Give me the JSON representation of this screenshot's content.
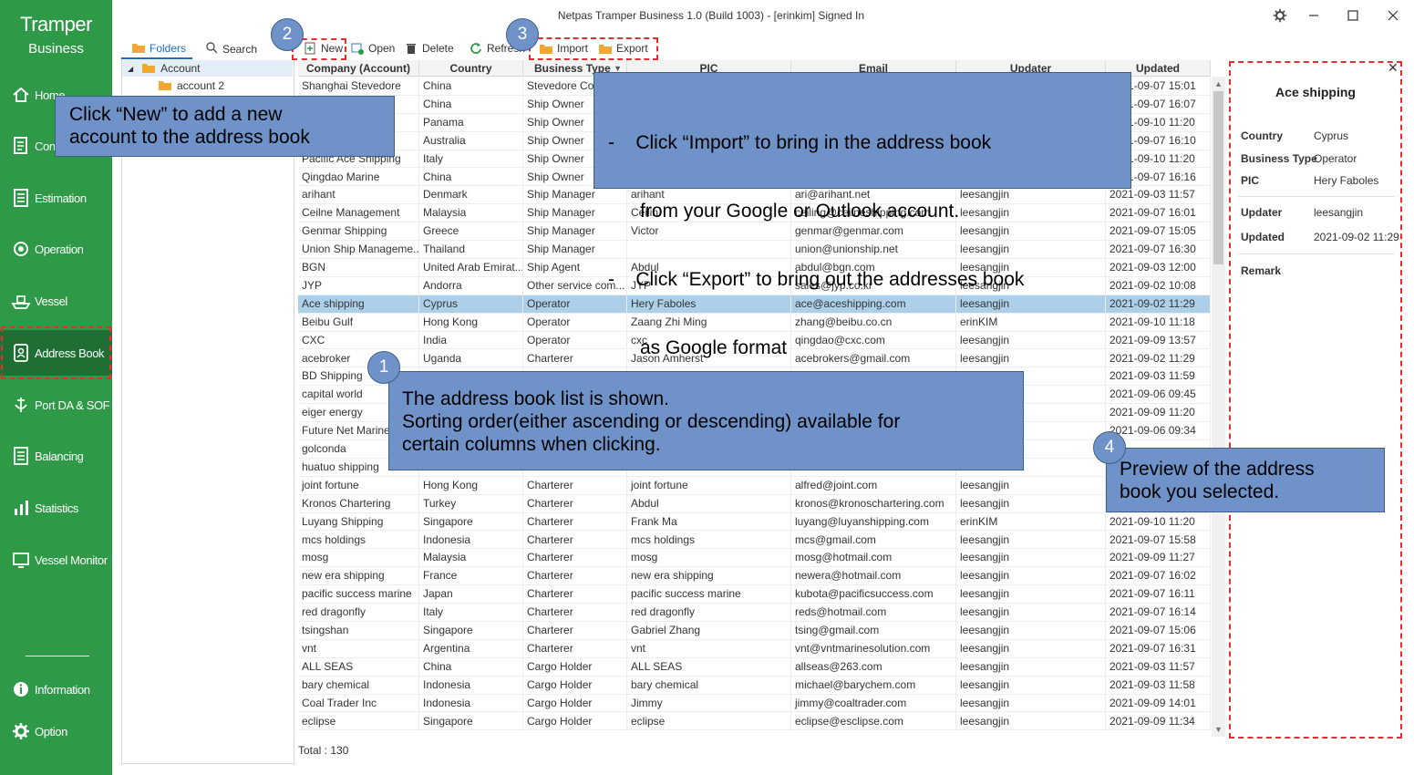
{
  "window": {
    "title": "Netpas Tramper Business 1.0 (Build 1003) - [erinkim] Signed In"
  },
  "brand": {
    "line1": "Tramper",
    "line2": "Business"
  },
  "sidebar": {
    "items": [
      {
        "label": "Home",
        "icon": "home-icon"
      },
      {
        "label": "Contract",
        "icon": "contract-icon"
      },
      {
        "label": "Estimation",
        "icon": "estimation-icon"
      },
      {
        "label": "Operation",
        "icon": "operation-icon"
      },
      {
        "label": "Vessel",
        "icon": "vessel-icon"
      },
      {
        "label": "Address Book",
        "icon": "address-book-icon"
      },
      {
        "label": "Port DA & SOF",
        "icon": "port-icon"
      },
      {
        "label": "Balancing",
        "icon": "balancing-icon"
      },
      {
        "label": "Statistics",
        "icon": "statistics-icon"
      },
      {
        "label": "Vessel Monitor",
        "icon": "vessel-monitor-icon"
      }
    ],
    "bottom": [
      {
        "label": "Information",
        "icon": "info-icon"
      },
      {
        "label": "Option",
        "icon": "gear-icon"
      }
    ]
  },
  "panel": {
    "tabs": {
      "folders": "Folders",
      "search": "Search"
    },
    "tree": {
      "root": "Account",
      "child": "account 2"
    }
  },
  "toolbar": {
    "new": "New",
    "open": "Open",
    "delete": "Delete",
    "refresh": "Refresh",
    "import": "Import",
    "export": "Export"
  },
  "table": {
    "columns": [
      "Company (Account)",
      "Country",
      "Business Type",
      "PIC",
      "Email",
      "Updater",
      "Updated"
    ],
    "rows": [
      [
        "Shanghai Stevedore",
        "China",
        "Stevedore Com...",
        "",
        "",
        "",
        "2021-09-07 15:01"
      ],
      [
        "",
        "China",
        "Ship Owner",
        "",
        "",
        "",
        "2021-09-07 16:07"
      ],
      [
        "",
        "Panama",
        "Ship Owner",
        "",
        "",
        "",
        "2021-09-10 11:20"
      ],
      [
        "",
        "Australia",
        "Ship Owner",
        "",
        "",
        "",
        "2021-09-07 16:10"
      ],
      [
        "Pacific Ace Shipping",
        "Italy",
        "Ship Owner",
        "",
        "",
        "",
        "2021-09-10 11:20"
      ],
      [
        "Qingdao Marine",
        "China",
        "Ship Owner",
        "",
        "",
        "",
        "2021-09-07 16:16"
      ],
      [
        "arihant",
        "Denmark",
        "Ship Manager",
        "arihant",
        "ari@arihant.net",
        "leesangjin",
        "2021-09-03 11:57"
      ],
      [
        "Ceilne Management",
        "Malaysia",
        "Ship Manager",
        "Ceilin",
        "ceiling@ceilneshipping.com",
        "leesangjin",
        "2021-09-07 16:01"
      ],
      [
        "Genmar Shipping",
        "Greece",
        "Ship Manager",
        "Victor",
        "genmar@genmar.com",
        "leesangjin",
        "2021-09-07 15:05"
      ],
      [
        "Union Ship Manageme...",
        "Thailand",
        "Ship Manager",
        "",
        "union@unionship.net",
        "leesangjin",
        "2021-09-07 16:30"
      ],
      [
        "BGN",
        "United Arab Emirat...",
        "Ship Agent",
        "Abdul",
        "abdul@bgn.com",
        "leesangjin",
        "2021-09-03 12:00"
      ],
      [
        "JYP",
        "Andorra",
        "Other service com...",
        "JYP",
        "sales@jyp.co.kr",
        "leesangjin",
        "2021-09-02 10:08"
      ],
      [
        "Ace shipping",
        "Cyprus",
        "Operator",
        "Hery Faboles",
        "ace@aceshipping.com",
        "leesangjin",
        "2021-09-02 11:29"
      ],
      [
        "Beibu Gulf",
        "Hong Kong",
        "Operator",
        "Zaang Zhi Ming",
        "zhang@beibu.co.cn",
        "erinKIM",
        "2021-09-10 11:18"
      ],
      [
        "CXC",
        "India",
        "Operator",
        "cxc",
        "qingdao@cxc.com",
        "leesangjin",
        "2021-09-09 13:57"
      ],
      [
        "acebroker",
        "Uganda",
        "Charterer",
        "Jason Amherst",
        "acebrokers@gmail.com",
        "leesangjin",
        "2021-09-02 11:29"
      ],
      [
        "BD Shipping",
        "",
        "",
        "",
        "",
        "",
        "2021-09-03 11:59"
      ],
      [
        "capital world",
        "",
        "",
        "",
        "",
        "",
        "2021-09-06 09:45"
      ],
      [
        "eiger energy",
        "",
        "",
        "",
        "",
        "",
        "2021-09-09 11:20"
      ],
      [
        "Future Net Marine",
        "",
        "",
        "",
        "",
        "",
        "2021-09-06 09:34"
      ],
      [
        "golconda",
        "",
        "",
        "",
        "",
        "",
        ""
      ],
      [
        "huatuo shipping",
        "",
        "",
        "",
        "",
        "",
        ""
      ],
      [
        "joint fortune",
        "Hong Kong",
        "Charterer",
        "joint fortune",
        "alfred@joint.com",
        "leesangjin",
        ""
      ],
      [
        "Kronos Chartering",
        "Turkey",
        "Charterer",
        "Abdul",
        "kronos@kronoschartering.com",
        "leesangjin",
        ""
      ],
      [
        "Luyang Shipping",
        "Singapore",
        "Charterer",
        "Frank Ma",
        "luyang@luyanshipping.com",
        "erinKIM",
        "2021-09-10 11:20"
      ],
      [
        "mcs holdings",
        "Indonesia",
        "Charterer",
        "mcs holdings",
        "mcs@gmail.com",
        "leesangjin",
        "2021-09-07 15:58"
      ],
      [
        "mosg",
        "Malaysia",
        "Charterer",
        "mosg",
        "mosg@hotmail.com",
        "leesangjin",
        "2021-09-09 11:27"
      ],
      [
        "new era shipping",
        "France",
        "Charterer",
        "new era shipping",
        "newera@hotmail.com",
        "leesangjin",
        "2021-09-07 16:02"
      ],
      [
        "pacific success marine",
        "Japan",
        "Charterer",
        "pacific success marine",
        "kubota@pacificsuccess.com",
        "leesangjin",
        "2021-09-07 16:11"
      ],
      [
        "red dragonfly",
        "Italy",
        "Charterer",
        "red dragonfly",
        "reds@hotmail.com",
        "leesangjin",
        "2021-09-07 16:14"
      ],
      [
        "tsingshan",
        "Singapore",
        "Charterer",
        "Gabriel Zhang",
        "tsing@gmail.com",
        "leesangjin",
        "2021-09-07 15:06"
      ],
      [
        "vnt",
        "Argentina",
        "Charterer",
        "vnt",
        "vnt@vntmarinesolution.com",
        "leesangjin",
        "2021-09-07 16:31"
      ],
      [
        "ALL SEAS",
        "China",
        "Cargo Holder",
        "ALL SEAS",
        "allseas@263.com",
        "leesangjin",
        "2021-09-03 11:57"
      ],
      [
        "bary chemical",
        "Indonesia",
        "Cargo Holder",
        "bary chemical",
        "michael@barychem.com",
        "leesangjin",
        "2021-09-03 11:58"
      ],
      [
        "Coal Trader Inc",
        "Indonesia",
        "Cargo Holder",
        "Jimmy",
        "jimmy@coaltrader.com",
        "leesangjin",
        "2021-09-09 14:01"
      ],
      [
        "eclipse",
        "Singapore",
        "Cargo Holder",
        "eclipse",
        "eclipse@esclipse.com",
        "leesangjin",
        "2021-09-09 11:34"
      ]
    ],
    "selected_row": 12,
    "total": "Total : 130"
  },
  "preview": {
    "title": "Ace shipping",
    "fields": [
      {
        "label": "Country",
        "value": "Cyprus"
      },
      {
        "label": "Business Type",
        "value": "Operator"
      },
      {
        "label": "PIC",
        "value": "Hery Faboles"
      },
      {
        "label": "Updater",
        "value": "leesangjin"
      },
      {
        "label": "Updated",
        "value": "2021-09-02 11:29"
      },
      {
        "label": "Remark",
        "value": ""
      }
    ]
  },
  "annotations": {
    "badges": [
      "1",
      "2",
      "3",
      "4"
    ],
    "callout_new": [
      "Click “New” to add a new",
      "account to the address book"
    ],
    "callout_import": [
      "-    Click “Import” to bring in the address book",
      "      from your Google or Outlook account.",
      "-    Click “Export” to bring out the addresses book",
      "      as Google format"
    ],
    "callout_list": [
      "The address book list is shown.",
      "Sorting order(either ascending or descending) available for",
      "certain columns when clicking."
    ],
    "callout_preview": [
      "Preview of the address",
      "book you selected."
    ]
  },
  "colors": {
    "sidebar": "#2e9a47",
    "sidebar_active": "#1f6e33",
    "callout": "#6f93c8",
    "selection": "#add0ea",
    "highlight": "#e03030"
  }
}
